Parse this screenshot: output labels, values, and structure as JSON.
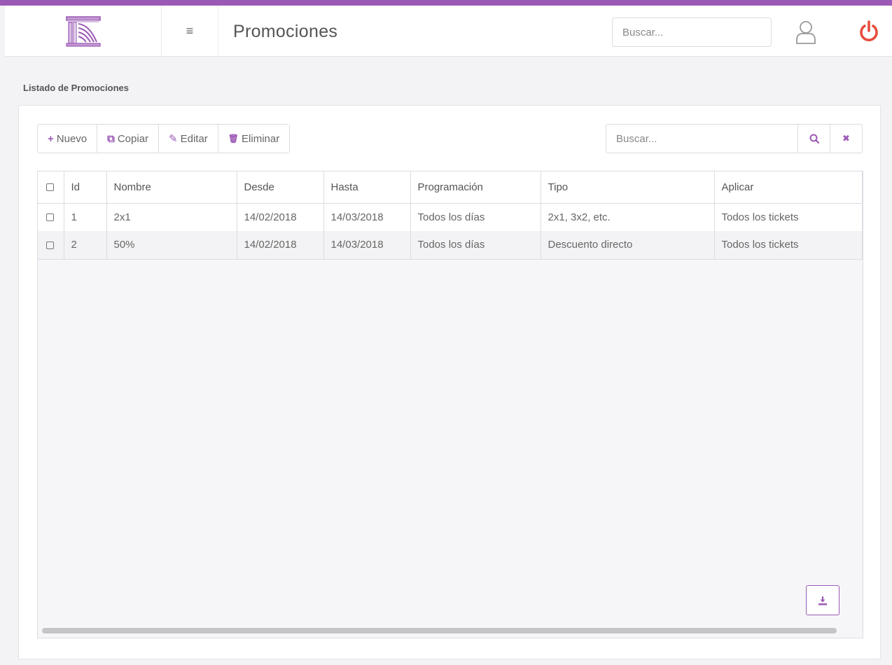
{
  "header": {
    "title": "Promociones",
    "search_placeholder": "Buscar...",
    "menu_icon": "≡",
    "accent_color": "#9b59b6",
    "power_color": "#e74c3c"
  },
  "section": {
    "label": "Listado de Promociones"
  },
  "toolbar": {
    "new_icon": "+",
    "new_label": "Nuevo",
    "copy_icon": "⧉",
    "copy_label": "Copiar",
    "edit_icon": "✎",
    "edit_label": "Editar",
    "delete_icon": "🗑",
    "delete_label": "Eliminar"
  },
  "grid_search": {
    "placeholder": "Buscar...",
    "search_icon": "🔍",
    "clear_icon": "✖"
  },
  "table": {
    "columns": [
      "Id",
      "Nombre",
      "Desde",
      "Hasta",
      "Programación",
      "Tipo",
      "Aplicar"
    ],
    "rows": [
      [
        "1",
        "2x1",
        "14/02/2018",
        "14/03/2018",
        "Todos los días",
        "2x1, 3x2, etc.",
        "Todos los tickets"
      ],
      [
        "2",
        "50%",
        "14/02/2018",
        "14/03/2018",
        "Todos los días",
        "Descuento directo",
        "Todos los tickets"
      ]
    ]
  }
}
